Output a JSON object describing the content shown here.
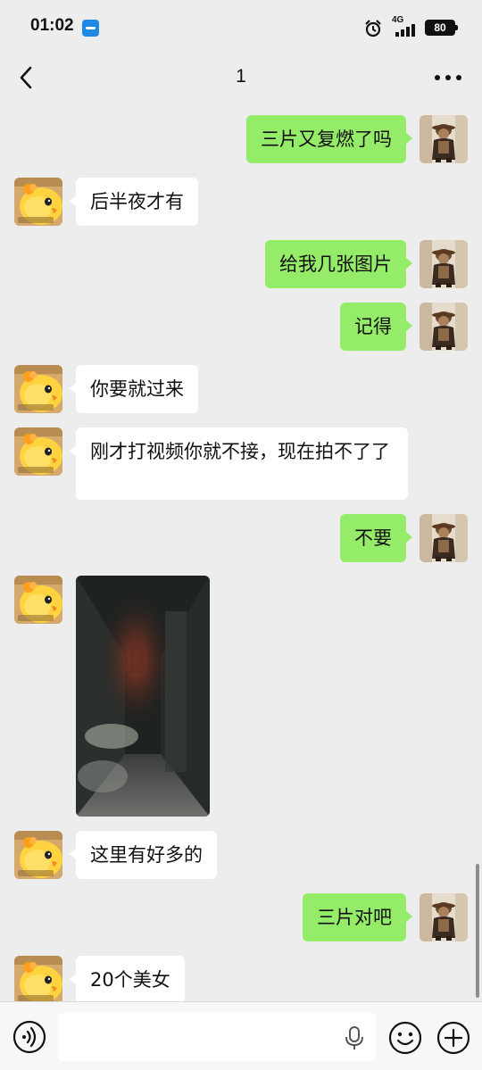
{
  "status_bar": {
    "time": "01:02",
    "network": "4G",
    "battery": "80"
  },
  "nav": {
    "title": "1"
  },
  "messages": [
    {
      "side": "right",
      "text": "三片又复燃了吗"
    },
    {
      "side": "left",
      "text": "后半夜才有"
    },
    {
      "side": "right",
      "text": "给我几张图片"
    },
    {
      "side": "right",
      "text": "记得"
    },
    {
      "side": "left",
      "text": "你要就过来"
    },
    {
      "side": "left",
      "text": "刚才打视频你就不接，现在拍不了了"
    },
    {
      "side": "right",
      "text": "不要"
    },
    {
      "side": "left",
      "type": "image"
    },
    {
      "side": "left",
      "text": "这里有好多的"
    },
    {
      "side": "right",
      "text": "三片对吧"
    },
    {
      "side": "left",
      "text": "20个美女"
    }
  ],
  "icons": {
    "back": "chevron-left-icon",
    "more": "more-dots-icon",
    "voice": "voice-icon",
    "mic": "mic-icon",
    "emoji": "emoji-icon",
    "add": "plus-icon",
    "alarm": "alarm-icon",
    "signal": "signal-icon"
  },
  "colors": {
    "sent_bubble": "#95ec69",
    "received_bubble": "#ffffff",
    "chat_background": "#ededed"
  }
}
